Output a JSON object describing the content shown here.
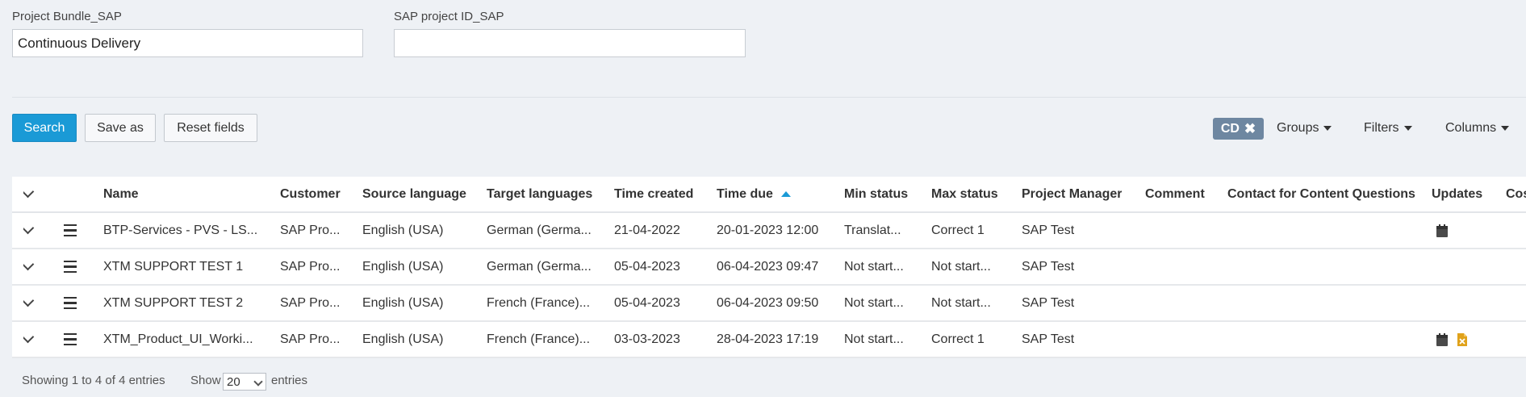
{
  "filters": {
    "project_bundle_label": "Project Bundle_SAP",
    "project_bundle_value": "Continuous Delivery",
    "sap_project_id_label": "SAP project ID_SAP",
    "sap_project_id_value": ""
  },
  "toolbar": {
    "search_label": "Search",
    "save_as_label": "Save as",
    "reset_label": "Reset fields",
    "tag_label": "CD",
    "tag_remove": "✖",
    "groups_label": "Groups",
    "filters_label": "Filters",
    "columns_label": "Columns"
  },
  "table": {
    "headers": [
      "Name",
      "Customer",
      "Source language",
      "Target languages",
      "Time created",
      "Time due",
      "Min status",
      "Max status",
      "Project Manager",
      "Comment",
      "Contact for Content Questions",
      "Updates",
      "Cos"
    ],
    "rows": [
      {
        "name": "BTP-Services - PVS - LS...",
        "customer": "SAP Pro...",
        "source": "English (USA)",
        "target": "German (Germa...",
        "created": "21-04-2022",
        "due": "20-01-2023 12:00",
        "min_status": "Translat...",
        "max_status": "Correct 1",
        "pm": "SAP Test",
        "updates": [
          "calendar-icon"
        ]
      },
      {
        "name": "XTM SUPPORT TEST 1",
        "customer": "SAP Pro...",
        "source": "English (USA)",
        "target": "German (Germa...",
        "created": "05-04-2023",
        "due": "06-04-2023 09:47",
        "min_status": "Not start...",
        "max_status": "Not start...",
        "pm": "SAP Test",
        "updates": []
      },
      {
        "name": "XTM SUPPORT TEST 2",
        "customer": "SAP Pro...",
        "source": "English (USA)",
        "target": "French (France)...",
        "created": "05-04-2023",
        "due": "06-04-2023 09:50",
        "min_status": "Not start...",
        "max_status": "Not start...",
        "pm": "SAP Test",
        "updates": []
      },
      {
        "name": "XTM_Product_UI_Worki...",
        "customer": "SAP Pro...",
        "source": "English (USA)",
        "target": "French (France)...",
        "created": "03-03-2023",
        "due": "28-04-2023 17:19",
        "min_status": "Not start...",
        "max_status": "Correct 1",
        "pm": "SAP Test",
        "updates": [
          "calendar-icon",
          "file-excel-icon"
        ]
      }
    ]
  },
  "footer": {
    "showing": "Showing 1 to 4 of 4 entries",
    "show_label": "Show",
    "page_size": "20",
    "entries_label": "entries"
  },
  "colors": {
    "primary": "#1a9ad6",
    "tag": "#6e87a1",
    "excel_icon": "#e0a21b"
  }
}
